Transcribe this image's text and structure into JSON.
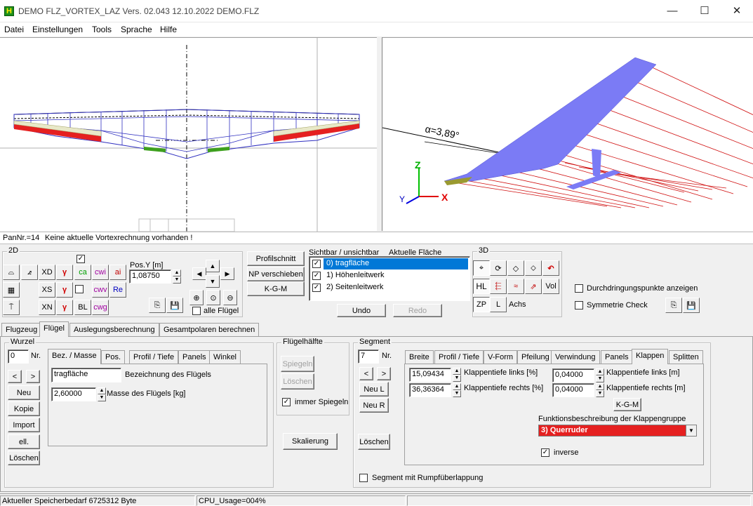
{
  "window": {
    "title": "DEMO  FLZ_VORTEX_LAZ Vers. 02.043 12.10.2022 DEMO.FLZ",
    "icon_letter": "H",
    "minimize": "—",
    "maximize": "☐",
    "close": "✕"
  },
  "menu": [
    "Datei",
    "Einstellungen",
    "Tools",
    "Sprache",
    "Hilfe"
  ],
  "view3d": {
    "angle_label": "α=3,89°",
    "axis_x": "X",
    "axis_y": "Y",
    "axis_z": "Z"
  },
  "status_line": {
    "pan": "PanNr.=14",
    "message": "Keine aktuelle Vortexrechnung vorhanden !"
  },
  "toolbar2d": {
    "group_label": "2D",
    "buttons_r1": [
      "XD",
      "ca",
      "cwi",
      "ai"
    ],
    "buttons_r2": [
      "XS",
      "cwv",
      "Re"
    ],
    "buttons_r3": [
      "XN",
      "BL",
      "cwg"
    ],
    "pos_label": "Pos.Y [m]",
    "pos_value": "1,08750",
    "alle_fluegel": "alle Flügel"
  },
  "center_buttons": [
    "Profilschnitt",
    "NP verschieben",
    "K-G-M"
  ],
  "visibility": {
    "header_left": "Sichtbar / unsichtbar",
    "header_right": "Aktuelle Fläche",
    "items": [
      "0) tragfläche",
      "1) Höhenleitwerk",
      "2) Seitenleitwerk"
    ],
    "undo": "Undo",
    "redo": "Redo"
  },
  "toolbar3d": {
    "group_label": "3D",
    "hl": "HL",
    "vol": "Vol",
    "zp": "ZP",
    "l": "L",
    "achs": "Achs",
    "durchdringung": "Durchdringungspunkte anzeigen",
    "symmetrie": "Symmetrie Check"
  },
  "main_tabs": [
    "Flugzeug",
    "Flügel",
    "Auslegungsberechnung",
    "Gesamtpolaren berechnen"
  ],
  "wurzel": {
    "label": "Wurzel",
    "nr_value": "0",
    "nr_label": "Nr.",
    "prev": "<",
    "next": ">",
    "buttons": [
      "Neu",
      "Kopie",
      "Import",
      "ell.",
      "Löschen"
    ],
    "tabs": [
      "Bez. / Masse",
      "Pos.",
      "Profil / Tiefe",
      "Panels",
      "Winkel"
    ],
    "name_value": "tragfläche",
    "name_label": "Bezeichnung des Flügels",
    "mass_value": "2,60000",
    "mass_label": "Masse des Flügels [kg]"
  },
  "fluegelhaelfte": {
    "label": "Flügelhälfte",
    "spiegeln": "Spiegeln",
    "loeschen": "Löschen",
    "immer_spiegeln": "immer Spiegeln",
    "skalierung": "Skalierung"
  },
  "segment": {
    "label": "Segment",
    "nr_value": "7",
    "nr_label": "Nr.",
    "prev": "<",
    "next": ">",
    "neu_l": "Neu L",
    "neu_r": "Neu R",
    "loeschen": "Löschen",
    "tabs": [
      "Breite",
      "Profil / Tiefe",
      "V-Form",
      "Pfeilung",
      "Verwindung",
      "Panels",
      "Klappen",
      "Splitten"
    ],
    "klappe_links_pct_value": "15,09434",
    "klappe_links_pct_label": "Klappentiefe links [%]",
    "klappe_rechts_pct_value": "36,36364",
    "klappe_rechts_pct_label": "Klappentiefe rechts [%]",
    "klappe_links_m_value": "0,04000",
    "klappe_links_m_label": "Klappentiefe links [m]",
    "klappe_rechts_m_value": "0,04000",
    "klappe_rechts_m_label": "Klappentiefe rechts [m]",
    "kgm": "K-G-M",
    "funktion_label": "Funktionsbeschreibung der Klappengruppe",
    "funktion_value": "3) Querruder",
    "inverse": "inverse",
    "rumpf": "Segment mit Rumpfüberlappung"
  },
  "statusbar": {
    "memory": "Aktueller Speicherbedarf 6725312 Byte",
    "cpu": "CPU_Usage=004%"
  },
  "colors": {
    "mesh": "#3030c0",
    "flap_red": "#e52020",
    "flap_green": "#3ea01e",
    "wing_3d": "#7b7bf5",
    "wake_lines": "#d01010",
    "select_blue": "#0078d7"
  }
}
